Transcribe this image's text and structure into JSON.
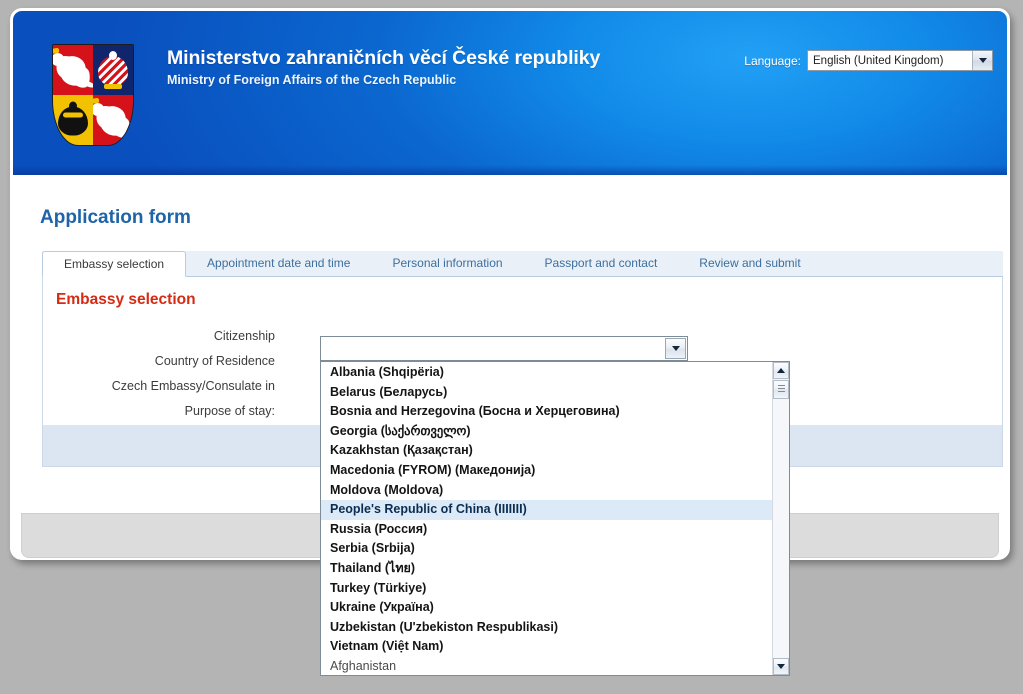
{
  "masthead": {
    "title_cs": "Ministerstvo zahraničních věcí České republiky",
    "title_en": "Ministry of Foreign Affairs of the Czech Republic",
    "coat_of_arms_icon": "czech-coat-of-arms",
    "language": {
      "label": "Language:",
      "value": "English (United Kingdom)",
      "caret_icon": "chevron-down-icon"
    }
  },
  "page": {
    "title": "Application form"
  },
  "tabs": [
    {
      "label": "Embassy selection",
      "active": true
    },
    {
      "label": "Appointment date and time",
      "active": false
    },
    {
      "label": "Personal information",
      "active": false
    },
    {
      "label": "Passport and contact",
      "active": false
    },
    {
      "label": "Review and submit",
      "active": false
    }
  ],
  "form": {
    "section_title": "Embassy selection",
    "labels": [
      "Citizenship",
      "Country of Residence",
      "Czech Embassy/Consulate in",
      "Purpose of stay:"
    ],
    "citizenship": {
      "value": "",
      "placeholder": "",
      "dropdown_button_icon": "chevron-down-icon",
      "expanded": true
    }
  },
  "dropdown": {
    "scroll_up_icon": "chevron-up-icon",
    "scroll_down_icon": "chevron-down-icon",
    "scrollbar_thumb_icon": "scrollbar-thumb",
    "items": [
      {
        "label": "Albania (Shqipëria)",
        "selected": false,
        "plain": false
      },
      {
        "label": "Belarus (Беларусь)",
        "selected": false,
        "plain": false
      },
      {
        "label": "Bosnia and Herzegovina (Босна и Херцеговина)",
        "selected": false,
        "plain": false
      },
      {
        "label": "Georgia (საქართველო)",
        "selected": false,
        "plain": false
      },
      {
        "label": "Kazakhstan (Қазақстан)",
        "selected": false,
        "plain": false
      },
      {
        "label": "Macedonia (FYROM) (Македонија)",
        "selected": false,
        "plain": false
      },
      {
        "label": "Moldova (Moldova)",
        "selected": false,
        "plain": false
      },
      {
        "label": "People's Republic of China (IIIIIII)",
        "selected": true,
        "plain": false
      },
      {
        "label": "Russia (Россия)",
        "selected": false,
        "plain": false
      },
      {
        "label": "Serbia (Srbija)",
        "selected": false,
        "plain": false
      },
      {
        "label": "Thailand (ไทย)",
        "selected": false,
        "plain": false
      },
      {
        "label": "Turkey (Türkiye)",
        "selected": false,
        "plain": false
      },
      {
        "label": "Ukraine (Україна)",
        "selected": false,
        "plain": false
      },
      {
        "label": "Uzbekistan (U'zbekiston Respublikasi)",
        "selected": false,
        "plain": false
      },
      {
        "label": "Vietnam (Việt Nam)",
        "selected": false,
        "plain": false
      },
      {
        "label": "Afghanistan",
        "selected": false,
        "plain": true
      }
    ]
  },
  "colors": {
    "brand_blue": "#0b67cf",
    "page_title_blue": "#1f63a8",
    "section_red": "#d52b14",
    "panel_footer_blue": "#dce5f2",
    "selection_blue": "#dceaf7",
    "desktop_gray": "#b4b4b4"
  }
}
